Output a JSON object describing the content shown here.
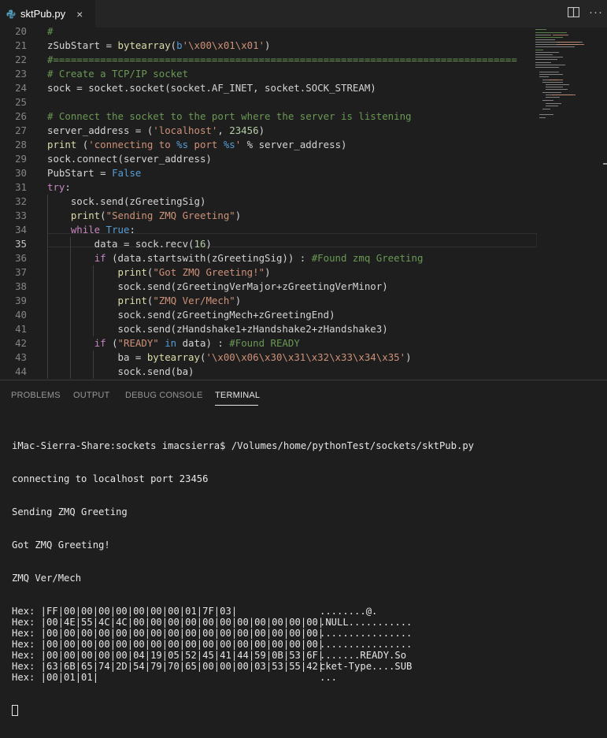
{
  "tab": {
    "filename": "sktPub.py",
    "close_glyph": "×"
  },
  "editor": {
    "lines": [
      {
        "n": "20",
        "tokens": [
          {
            "c": "cm",
            "t": "#"
          }
        ]
      },
      {
        "n": "21",
        "tokens": [
          {
            "c": "tx",
            "t": "zSubStart = "
          },
          {
            "c": "fn",
            "t": "bytearray"
          },
          {
            "c": "tx",
            "t": "("
          },
          {
            "c": "bl",
            "t": "b"
          },
          {
            "c": "st",
            "t": "'\\x00\\x01\\x01'"
          },
          {
            "c": "tx",
            "t": ")"
          }
        ]
      },
      {
        "n": "22",
        "tokens": [
          {
            "c": "cm",
            "t": "#==============================================================================="
          }
        ]
      },
      {
        "n": "23",
        "tokens": [
          {
            "c": "cm",
            "t": "# Create a TCP/IP socket"
          }
        ]
      },
      {
        "n": "24",
        "tokens": [
          {
            "c": "tx",
            "t": "sock = socket.socket(socket.AF_INET, socket.SOCK_STREAM)"
          }
        ]
      },
      {
        "n": "25",
        "tokens": []
      },
      {
        "n": "26",
        "tokens": [
          {
            "c": "cm",
            "t": "# Connect the socket to the port where the server is listening"
          }
        ]
      },
      {
        "n": "27",
        "tokens": [
          {
            "c": "tx",
            "t": "server_address = ("
          },
          {
            "c": "st",
            "t": "'localhost'"
          },
          {
            "c": "tx",
            "t": ", "
          },
          {
            "c": "nm",
            "t": "23456"
          },
          {
            "c": "tx",
            "t": ")"
          }
        ]
      },
      {
        "n": "28",
        "tokens": [
          {
            "c": "fn",
            "t": "print"
          },
          {
            "c": "tx",
            "t": " ("
          },
          {
            "c": "st",
            "t": "'connecting to "
          },
          {
            "c": "bl",
            "t": "%s"
          },
          {
            "c": "st",
            "t": " port "
          },
          {
            "c": "bl",
            "t": "%s"
          },
          {
            "c": "st",
            "t": "'"
          },
          {
            "c": "tx",
            "t": " % server_address)"
          }
        ]
      },
      {
        "n": "29",
        "tokens": [
          {
            "c": "tx",
            "t": "sock.connect(server_address)"
          }
        ]
      },
      {
        "n": "30",
        "tokens": [
          {
            "c": "tx",
            "t": "PubStart = "
          },
          {
            "c": "bl",
            "t": "False"
          }
        ]
      },
      {
        "n": "31",
        "tokens": [
          {
            "c": "kw",
            "t": "try"
          },
          {
            "c": "tx",
            "t": ":"
          }
        ]
      },
      {
        "n": "32",
        "tokens": [
          {
            "c": "tx",
            "t": "    sock.send(zGreetingSig)"
          }
        ]
      },
      {
        "n": "33",
        "tokens": [
          {
            "c": "tx",
            "t": "    "
          },
          {
            "c": "fn",
            "t": "print"
          },
          {
            "c": "tx",
            "t": "("
          },
          {
            "c": "st",
            "t": "\"Sending ZMQ Greeting\""
          },
          {
            "c": "tx",
            "t": ")"
          }
        ]
      },
      {
        "n": "34",
        "tokens": [
          {
            "c": "tx",
            "t": "    "
          },
          {
            "c": "kw",
            "t": "while"
          },
          {
            "c": "tx",
            "t": " "
          },
          {
            "c": "bl",
            "t": "True"
          },
          {
            "c": "tx",
            "t": ":"
          }
        ]
      },
      {
        "n": "35",
        "active": true,
        "tokens": [
          {
            "c": "tx",
            "t": "        data = sock.recv("
          },
          {
            "c": "nm",
            "t": "16"
          },
          {
            "c": "tx",
            "t": ")"
          }
        ]
      },
      {
        "n": "36",
        "tokens": [
          {
            "c": "tx",
            "t": "        "
          },
          {
            "c": "kw",
            "t": "if"
          },
          {
            "c": "tx",
            "t": " (data.startswith(zGreetingSig)) : "
          },
          {
            "c": "cm",
            "t": "#Found zmq Greeting"
          }
        ]
      },
      {
        "n": "37",
        "tokens": [
          {
            "c": "tx",
            "t": "            "
          },
          {
            "c": "fn",
            "t": "print"
          },
          {
            "c": "tx",
            "t": "("
          },
          {
            "c": "st",
            "t": "\"Got ZMQ Greeting!\""
          },
          {
            "c": "tx",
            "t": ")"
          }
        ]
      },
      {
        "n": "38",
        "tokens": [
          {
            "c": "tx",
            "t": "            sock.send(zGreetingVerMajor+zGreetingVerMinor)"
          }
        ]
      },
      {
        "n": "39",
        "tokens": [
          {
            "c": "tx",
            "t": "            "
          },
          {
            "c": "fn",
            "t": "print"
          },
          {
            "c": "tx",
            "t": "("
          },
          {
            "c": "st",
            "t": "\"ZMQ Ver/Mech\""
          },
          {
            "c": "tx",
            "t": ")"
          }
        ]
      },
      {
        "n": "40",
        "tokens": [
          {
            "c": "tx",
            "t": "            sock.send(zGreetingMech+zGreetingEnd)"
          }
        ]
      },
      {
        "n": "41",
        "tokens": [
          {
            "c": "tx",
            "t": "            sock.send(zHandshake1+zHandshake2+zHandshake3)"
          }
        ]
      },
      {
        "n": "42",
        "tokens": [
          {
            "c": "tx",
            "t": "        "
          },
          {
            "c": "kw",
            "t": "if"
          },
          {
            "c": "tx",
            "t": " ("
          },
          {
            "c": "st",
            "t": "\"READY\""
          },
          {
            "c": "tx",
            "t": " "
          },
          {
            "c": "bl",
            "t": "in"
          },
          {
            "c": "tx",
            "t": " data) : "
          },
          {
            "c": "cm",
            "t": "#Found READY"
          }
        ]
      },
      {
        "n": "43",
        "tokens": [
          {
            "c": "tx",
            "t": "            ba = "
          },
          {
            "c": "fn",
            "t": "bytearray"
          },
          {
            "c": "tx",
            "t": "("
          },
          {
            "c": "st",
            "t": "'\\x00\\x06\\x30\\x31\\x32\\x33\\x34\\x35'"
          },
          {
            "c": "tx",
            "t": ")"
          }
        ]
      },
      {
        "n": "44",
        "tokens": [
          {
            "c": "tx",
            "t": "            sock.send(ba)"
          }
        ]
      }
    ]
  },
  "panel": {
    "tabs": [
      "PROBLEMS",
      "OUTPUT",
      "DEBUG CONSOLE",
      "TERMINAL"
    ],
    "active_tab": "TERMINAL"
  },
  "terminal": {
    "lines": [
      "iMac-Sierra-Share:sockets imacsierra$ /Volumes/home/pythonTest/sockets/sktPub.py",
      "connecting to localhost port 23456",
      "Sending ZMQ Greeting",
      "Got ZMQ Greeting!",
      "ZMQ Ver/Mech"
    ],
    "hex": [
      {
        "left": "Hex: |FF|00|00|00|00|00|00|00|01|7F|03|",
        "right": "........@."
      },
      {
        "left": "Hex: |00|4E|55|4C|4C|00|00|00|00|00|00|00|00|00|00|00|",
        "right": ".NULL..........."
      },
      {
        "left": "Hex: |00|00|00|00|00|00|00|00|00|00|00|00|00|00|00|00|",
        "right": "................"
      },
      {
        "left": "Hex: |00|00|00|00|00|00|00|00|00|00|00|00|00|00|00|00|",
        "right": "................"
      },
      {
        "left": "Hex: |00|00|00|00|00|04|19|05|52|45|41|44|59|0B|53|6F|",
        "right": ".......READY.So"
      },
      {
        "left": "Hex: |63|6B|65|74|2D|54|79|70|65|00|00|00|03|53|55|42|",
        "right": "cket-Type....SUB"
      },
      {
        "left": "Hex: |00|01|01|",
        "right": "..."
      }
    ]
  }
}
